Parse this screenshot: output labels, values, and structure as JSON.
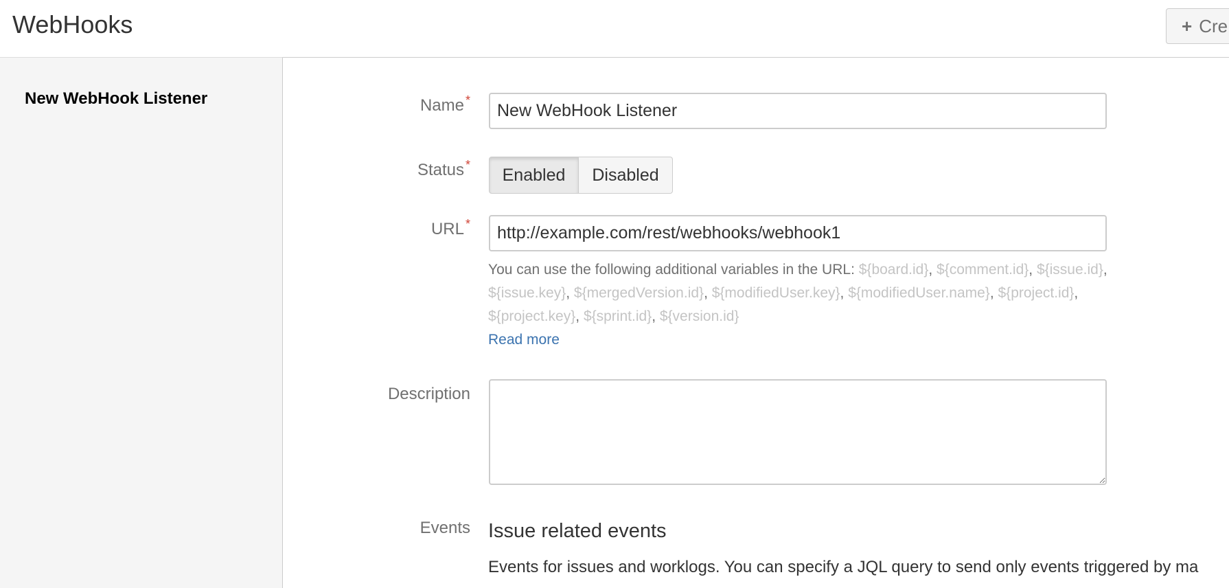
{
  "header": {
    "title": "WebHooks",
    "create_button_label": "Cre"
  },
  "sidebar": {
    "items": [
      {
        "label": "New WebHook Listener"
      }
    ]
  },
  "form": {
    "name": {
      "label": "Name",
      "required_marker": "*",
      "value": "New WebHook Listener"
    },
    "status": {
      "label": "Status",
      "required_marker": "*",
      "options": [
        "Enabled",
        "Disabled"
      ],
      "selected": "Enabled"
    },
    "url": {
      "label": "URL",
      "required_marker": "*",
      "value": "http://example.com/rest/webhooks/webhook1",
      "help_prefix": "You can use the following additional variables in the URL:",
      "variables": [
        "${board.id}",
        "${comment.id}",
        "${issue.id}",
        "${issue.key}",
        "${mergedVersion.id}",
        "${modifiedUser.key}",
        "${modifiedUser.name}",
        "${project.id}",
        "${project.key}",
        "${sprint.id}",
        "${version.id}"
      ],
      "read_more_label": "Read more"
    },
    "description": {
      "label": "Description",
      "value": ""
    },
    "events": {
      "label": "Events",
      "heading": "Issue related events",
      "description": "Events for issues and worklogs. You can specify a JQL query to send only events triggered by ma"
    }
  },
  "colors": {
    "required": "#d04437",
    "link": "#3b73af",
    "label": "#707070",
    "variable": "#c4c4c4",
    "sidebar_bg": "#f5f5f5"
  }
}
